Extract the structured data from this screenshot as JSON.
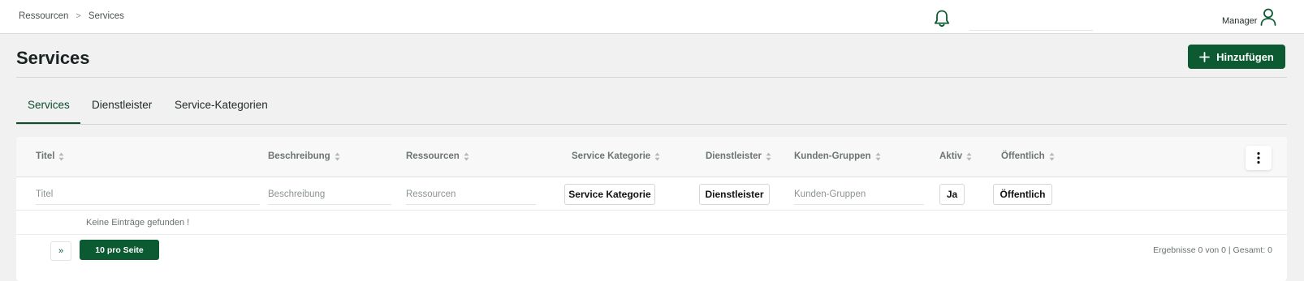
{
  "breadcrumb": {
    "items": [
      "Ressourcen",
      "Services"
    ],
    "separator": ">"
  },
  "header": {
    "search_value": "",
    "user_label": "Manager"
  },
  "page": {
    "title": "Services",
    "add_button_label": "Hinzufügen"
  },
  "tabs": [
    {
      "label": "Services",
      "active": true
    },
    {
      "label": "Dienstleister",
      "active": false
    },
    {
      "label": "Service-Kategorien",
      "active": false
    }
  ],
  "table": {
    "columns": [
      {
        "label": "Titel"
      },
      {
        "label": "Beschreibung"
      },
      {
        "label": "Ressourcen"
      },
      {
        "label": "Service Kategorie"
      },
      {
        "label": "Dienstleister"
      },
      {
        "label": "Kunden-Gruppen"
      },
      {
        "label": "Aktiv"
      },
      {
        "label": "Öffentlich"
      }
    ],
    "filters": {
      "title_placeholder": "Titel",
      "description_placeholder": "Beschreibung",
      "resources_placeholder": "Ressourcen",
      "service_category_button": "Service Kategorie",
      "provider_button": "Dienstleister",
      "customer_groups_placeholder": "Kunden-Gruppen",
      "active_button": "Ja",
      "public_button": "Öffentlich"
    },
    "empty_message": "Keine Einträge gefunden !"
  },
  "pagination": {
    "next_label": "»",
    "per_page_label": "10 pro Seite",
    "results_text": "Ergebnisse 0 von 0 | Gesamt: 0"
  },
  "colors": {
    "primary": "#0b5a32",
    "background": "#f0f1f0"
  },
  "icons": {
    "notifications": "bell-icon",
    "user": "user-icon",
    "add": "plus-icon",
    "sort": "sort-icon",
    "menu": "kebab-icon"
  }
}
